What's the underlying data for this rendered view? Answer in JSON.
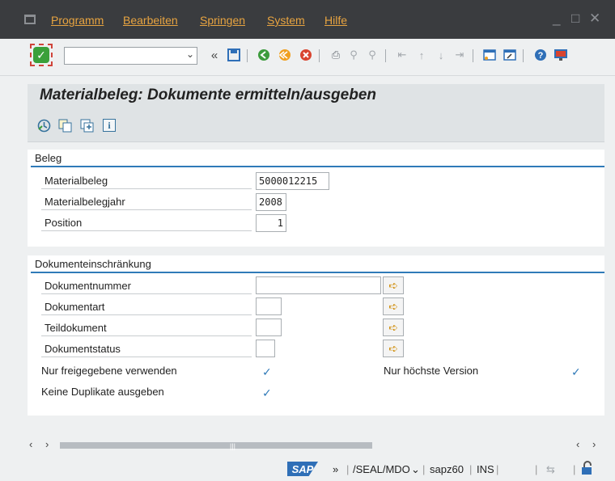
{
  "menu": {
    "items": [
      "Programm",
      "Bearbeiten",
      "Springen",
      "System",
      "Hilfe"
    ],
    "window_controls": [
      "_",
      "□",
      "✕"
    ]
  },
  "toolbar": {
    "command_field": {
      "value": "",
      "placeholder": ""
    },
    "ok_icon": "checkmark-icon",
    "back_glyph": "«"
  },
  "title": "Materialbeleg: Dokumente ermitteln/ausgeben",
  "app_toolbar": {
    "icons": [
      "execute-icon",
      "copy-variant-icon",
      "save-variant-icon",
      "info-icon"
    ],
    "info_glyph": "i"
  },
  "beleg": {
    "title": "Beleg",
    "fields": [
      {
        "label": "Materialbeleg",
        "value": "5000012215"
      },
      {
        "label": "Materialbelegjahr",
        "value": "2008"
      },
      {
        "label": "Position",
        "value": "1"
      }
    ]
  },
  "dok": {
    "title": "Dokumenteinschränkung",
    "fields": [
      {
        "label": "Dokumentnummer",
        "value": ""
      },
      {
        "label": "Dokumentart",
        "value": ""
      },
      {
        "label": "Teildokument",
        "value": ""
      },
      {
        "label": "Dokumentstatus",
        "value": ""
      }
    ],
    "checks": [
      {
        "label": "Nur freigegebene verwenden",
        "checked": true
      },
      {
        "label": "Keine Duplikate ausgeben",
        "checked": true
      },
      {
        "label": "Nur höchste Version",
        "checked": true
      }
    ]
  },
  "status": {
    "logo": "SAP",
    "more": "»",
    "system": "/SEAL/MDO",
    "server": "sapz60",
    "mode": "INS"
  },
  "colors": {
    "menubar_bg": "#3a3c3f",
    "menu_text": "#e8a440",
    "accent_blue": "#2f7ab8"
  }
}
